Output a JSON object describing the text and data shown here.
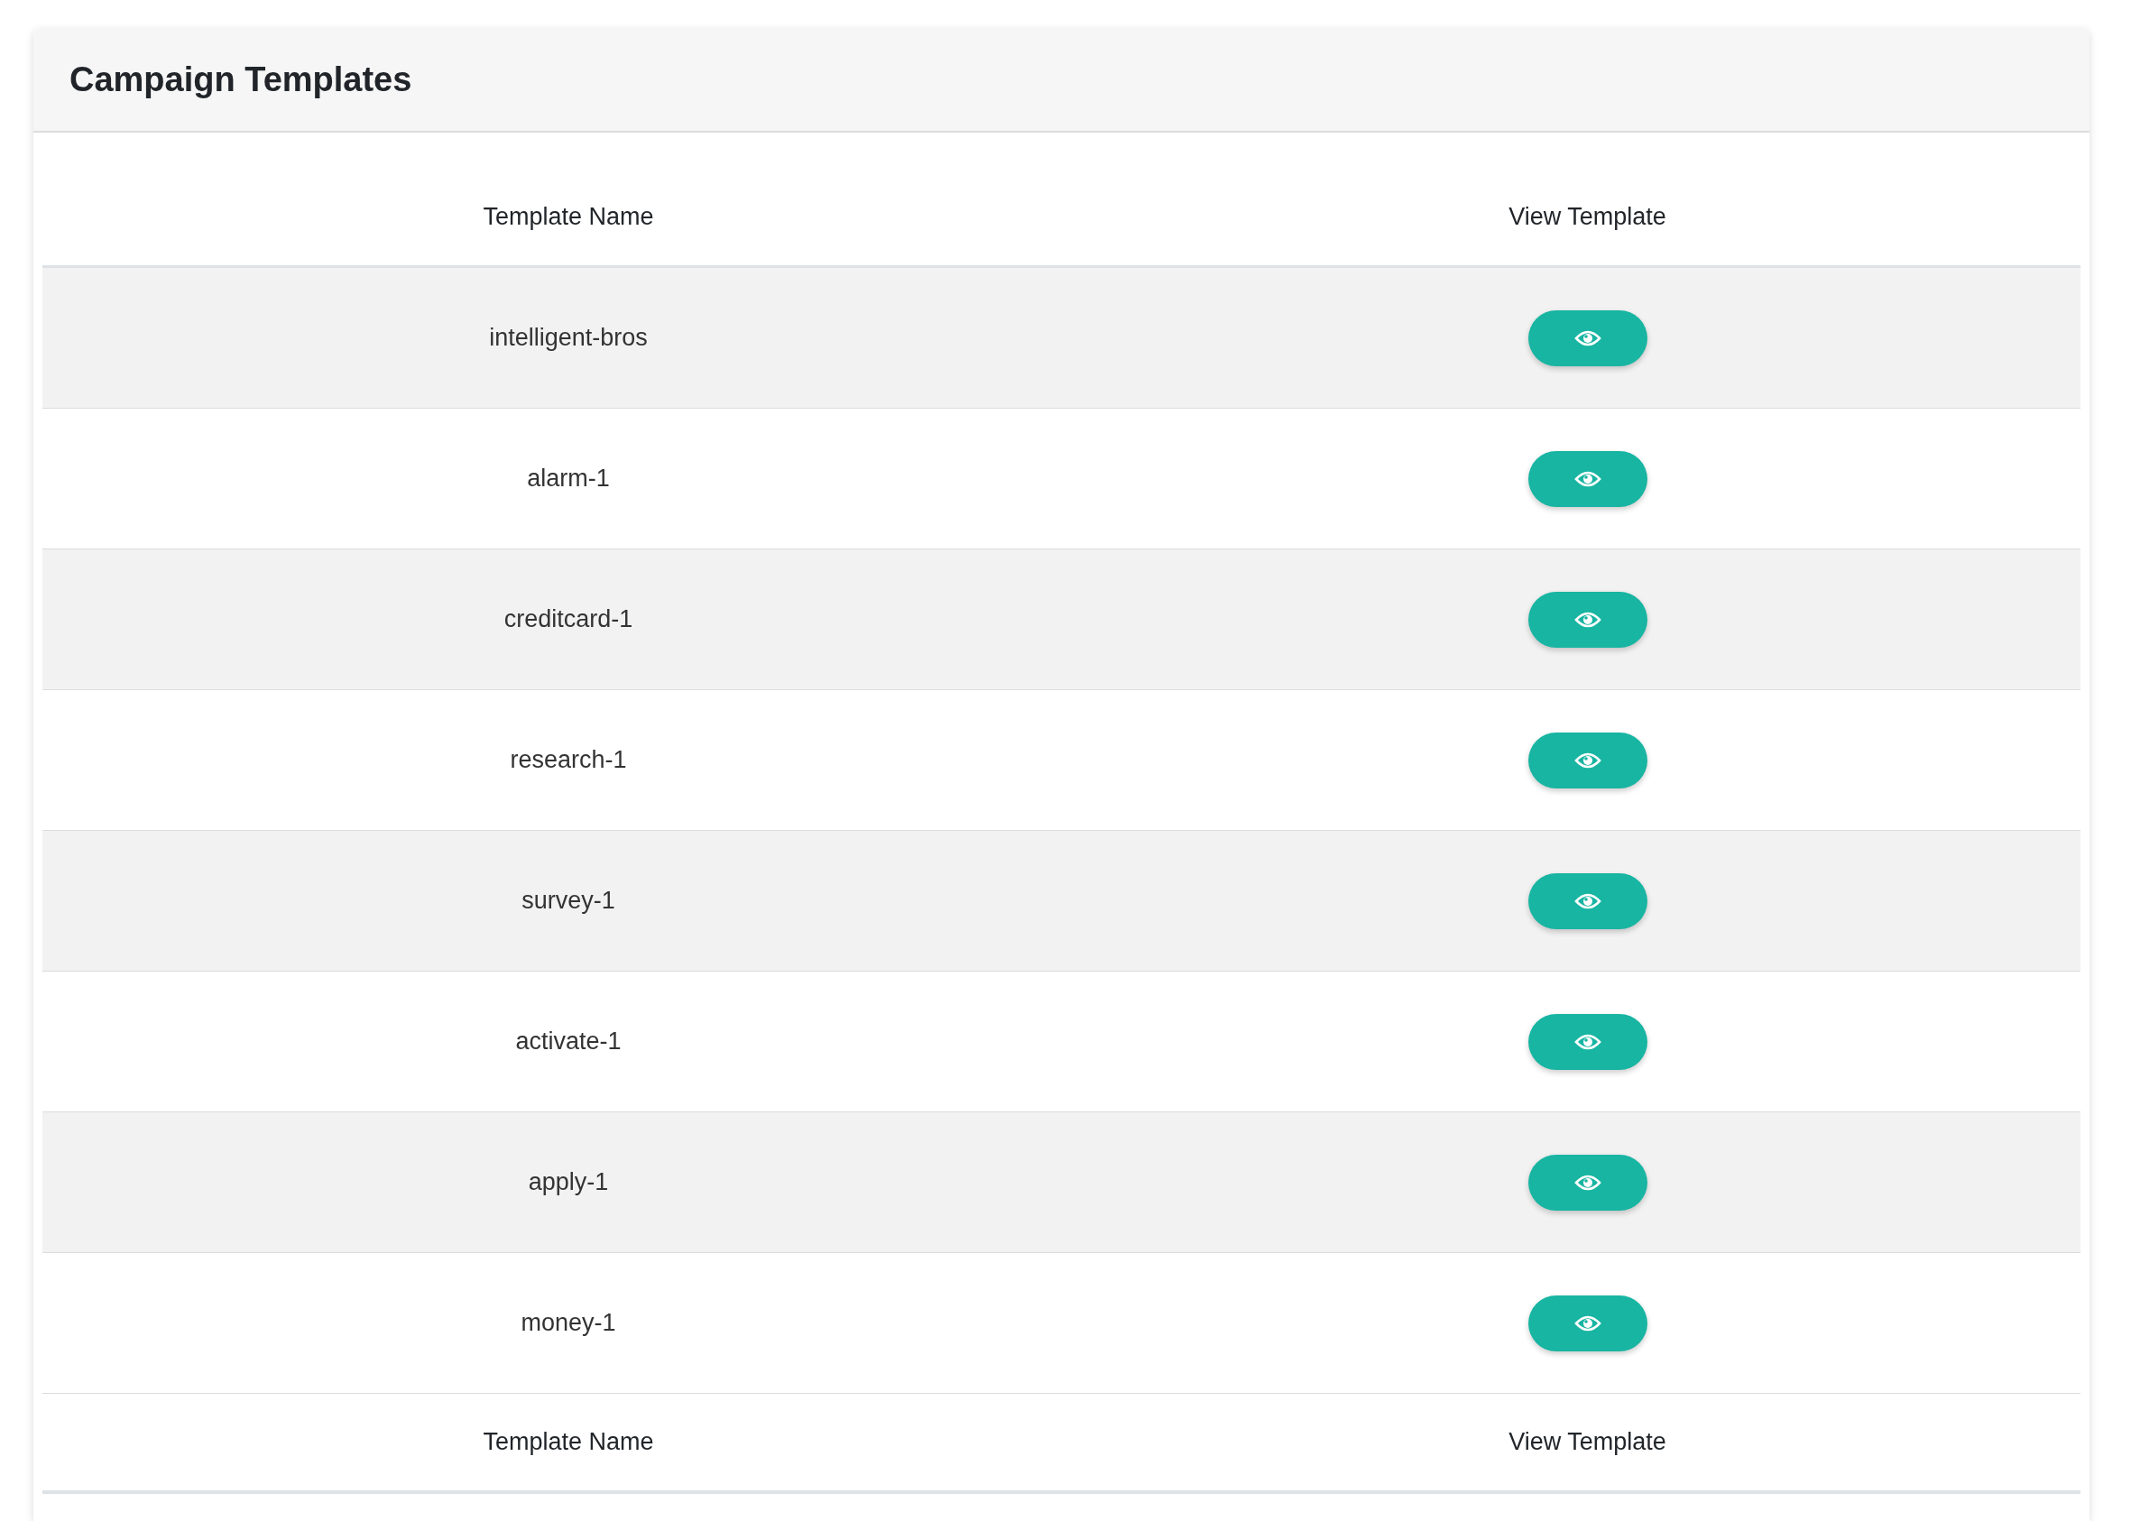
{
  "card": {
    "title": "Campaign Templates"
  },
  "table": {
    "columns": [
      "Template Name",
      "View Template"
    ],
    "rows": [
      {
        "name": "intelligent-bros"
      },
      {
        "name": "alarm-1"
      },
      {
        "name": "creditcard-1"
      },
      {
        "name": "research-1"
      },
      {
        "name": "survey-1"
      },
      {
        "name": "activate-1"
      },
      {
        "name": "apply-1"
      },
      {
        "name": "money-1"
      }
    ],
    "footer_columns": [
      "Template Name",
      "View Template"
    ]
  }
}
